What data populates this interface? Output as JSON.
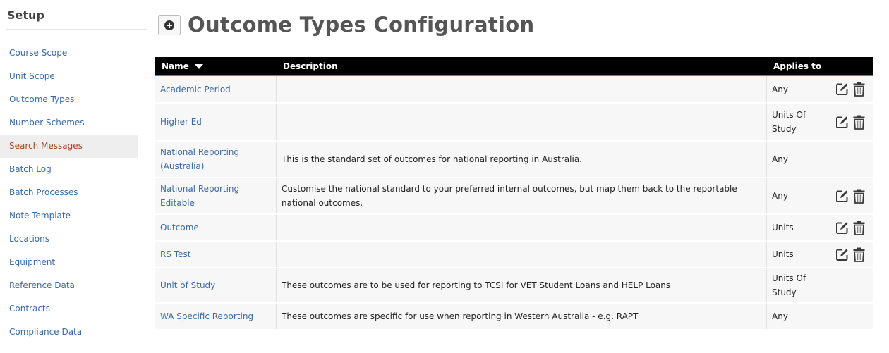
{
  "sidebar": {
    "title": "Setup",
    "items": [
      {
        "label": "Course Scope",
        "active": false
      },
      {
        "label": "Unit Scope",
        "active": false
      },
      {
        "label": "Outcome Types",
        "active": false
      },
      {
        "label": "Number Schemes",
        "active": false
      },
      {
        "label": "Search Messages",
        "active": true
      },
      {
        "label": "Batch Log",
        "active": false
      },
      {
        "label": "Batch Processes",
        "active": false
      },
      {
        "label": "Note Template",
        "active": false
      },
      {
        "label": "Locations",
        "active": false
      },
      {
        "label": "Equipment",
        "active": false
      },
      {
        "label": "Reference Data",
        "active": false
      },
      {
        "label": "Contracts",
        "active": false
      },
      {
        "label": "Compliance Data",
        "active": false
      }
    ]
  },
  "header": {
    "title": "Outcome Types Configuration",
    "add_icon": "plus-circle-icon"
  },
  "table": {
    "columns": {
      "name": "Name",
      "description": "Description",
      "applies_to": "Applies to"
    },
    "sort": {
      "column": "name",
      "direction": "descending"
    },
    "rows": [
      {
        "name": "Academic Period",
        "description": "",
        "applies_to": "Any",
        "editable": true
      },
      {
        "name": "Higher Ed",
        "description": "",
        "applies_to": "Units Of Study",
        "editable": true
      },
      {
        "name": "National Reporting (Australia)",
        "description": "This is the standard set of outcomes for national reporting in Australia.",
        "applies_to": "Any",
        "editable": false
      },
      {
        "name": "National Reporting Editable",
        "description": "Customise the national standard to your preferred internal outcomes, but map them back to the reportable national outcomes.",
        "applies_to": "Any",
        "editable": true
      },
      {
        "name": "Outcome",
        "description": "",
        "applies_to": "Units",
        "editable": true
      },
      {
        "name": "RS Test",
        "description": "",
        "applies_to": "Units",
        "editable": true
      },
      {
        "name": "Unit of Study",
        "description": "These outcomes are to be used for reporting to TCSI for VET Student Loans and HELP Loans",
        "applies_to": "Units Of Study",
        "editable": false
      },
      {
        "name": "WA Specific Reporting",
        "description": "These outcomes are specific for use when reporting in Western Australia - e.g. RAPT",
        "applies_to": "Any",
        "editable": false
      }
    ]
  },
  "icons": {
    "edit": "edit-icon",
    "delete": "trash-icon",
    "sort": "sort-down-icon"
  },
  "colors": {
    "link": "#3a6aa8",
    "active_nav": "#a8442a",
    "header_bg": "#000000",
    "header_accent": "#d15a2b",
    "row_bg": "#f7f7f7"
  }
}
